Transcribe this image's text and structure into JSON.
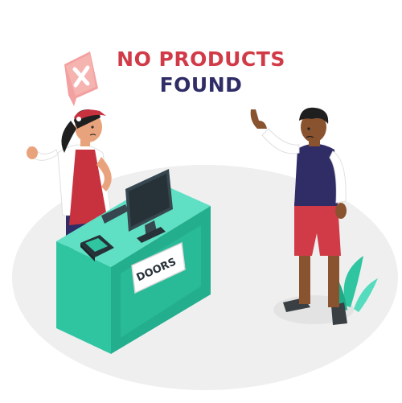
{
  "heading": {
    "line1": "NO PRODUCTS",
    "line2": "FOUND"
  },
  "desk_sign": {
    "label": "DOORS"
  },
  "icons": {
    "error_bubble": "close-x-icon",
    "cash_register": "card-terminal-icon",
    "monitor": "computer-monitor-icon",
    "plant": "plant-leaves-icon"
  },
  "colors": {
    "accent_red": "#d13b47",
    "accent_navy": "#2f2c66",
    "desk_teal": "#2fc5a1",
    "bubble_pink": "#f3a0a0"
  }
}
